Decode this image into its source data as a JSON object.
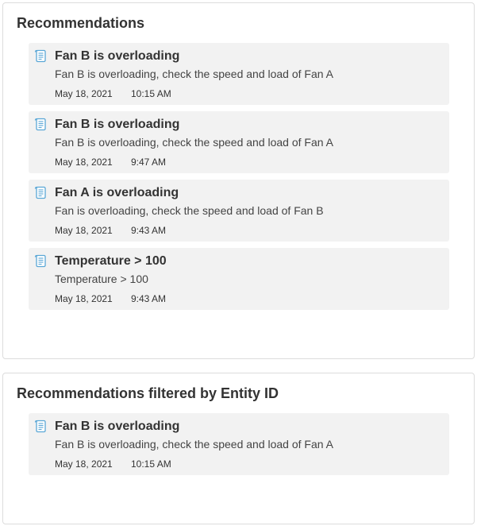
{
  "icon": "scroll-document-icon",
  "colors": {
    "card_background": "#f2f2f2",
    "icon_blue": "#5aa7d6",
    "panel_border": "#dcdcdc"
  },
  "panels": [
    {
      "title": "Recommendations",
      "cards": [
        {
          "title": "Fan B is overloading",
          "description": "Fan B is overloading, check the speed and load of Fan A",
          "date": "May 18, 2021",
          "time": "10:15 AM"
        },
        {
          "title": "Fan B is overloading",
          "description": "Fan B is overloading, check the speed and load of Fan A",
          "date": "May 18, 2021",
          "time": "9:47 AM"
        },
        {
          "title": "Fan A is overloading",
          "description": "Fan is overloading, check the speed and load of Fan B",
          "date": "May 18, 2021",
          "time": "9:43 AM"
        },
        {
          "title": "Temperature > 100",
          "description": "Temperature > 100",
          "date": "May 18, 2021",
          "time": "9:43 AM"
        }
      ]
    },
    {
      "title": "Recommendations filtered by Entity ID",
      "cards": [
        {
          "title": "Fan B is overloading",
          "description": "Fan B is overloading, check the speed and load of Fan A",
          "date": "May 18, 2021",
          "time": "10:15 AM"
        }
      ]
    }
  ]
}
